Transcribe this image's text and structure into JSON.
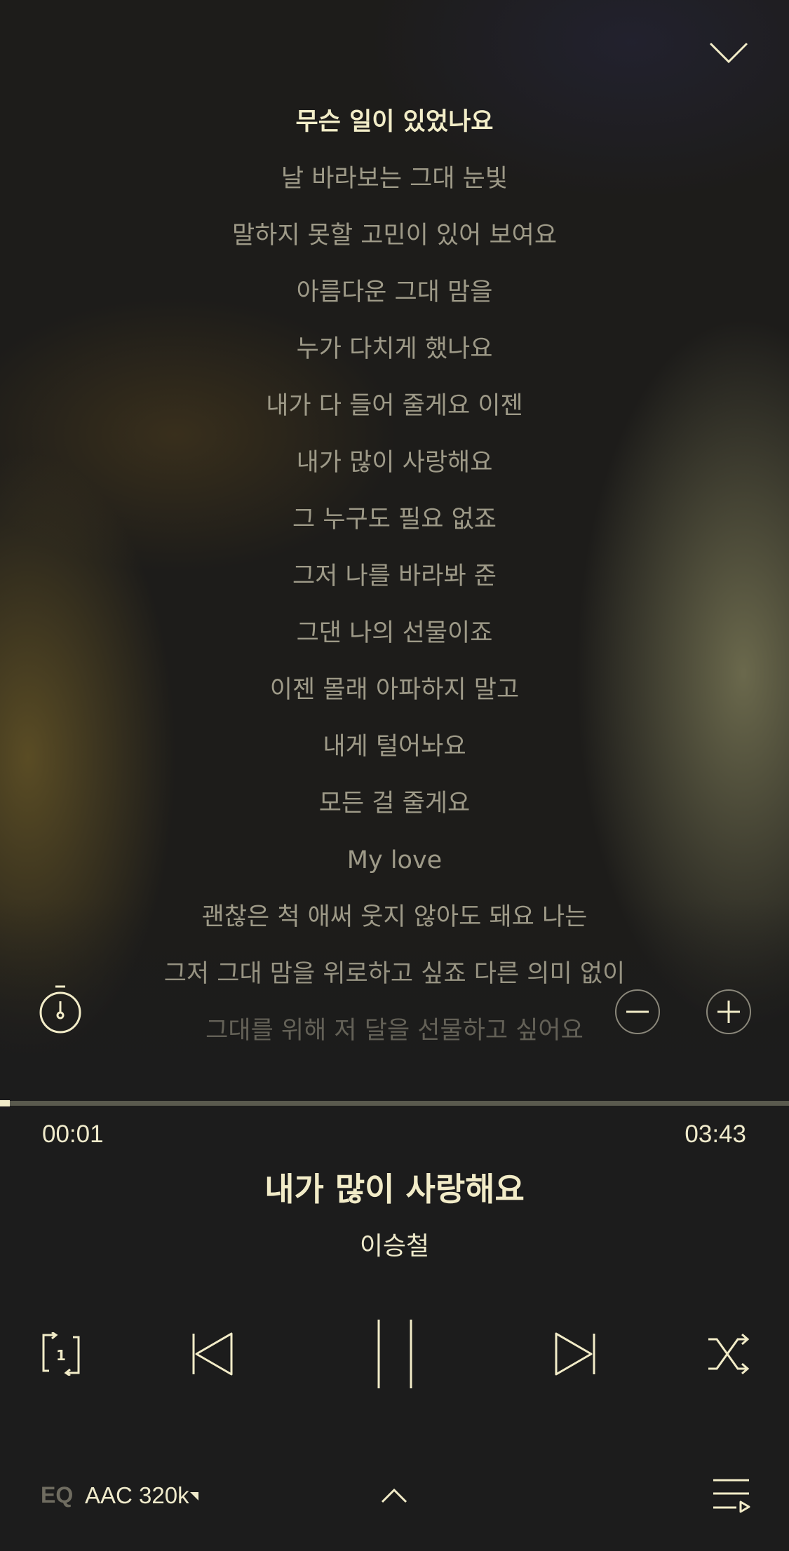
{
  "colors": {
    "accent": "#f2ecc8",
    "lyric_inactive": "#9e9a88",
    "background": "#1c1c1c"
  },
  "lyrics": [
    "무슨 일이 있었나요",
    "날 바라보는 그대 눈빛",
    "말하지 못할 고민이 있어 보여요",
    "아름다운 그대 맘을",
    "누가 다치게 했나요",
    "내가 다 들어 줄게요 이젠",
    "내가 많이 사랑해요",
    "그 누구도 필요 없죠",
    "그저 나를 바라봐 준",
    "그댄 나의 선물이죠",
    "이젠 몰래 아파하지 말고",
    "내게 털어놔요",
    "모든 걸 줄게요",
    "My love",
    "괜찮은 척 애써 웃지 않아도 돼요 나는",
    "그저 그대 맘을 위로하고 싶죠 다른 의미 없이",
    "그대를 위해 저 달을 선물하고 싶어요"
  ],
  "current_lyric_index": 0,
  "progress": {
    "elapsed": "00:01",
    "total": "03:43",
    "fraction": 0.005
  },
  "track": {
    "title": "내가 많이 사랑해요",
    "artist": "이승철"
  },
  "icons": {
    "collapse": "chevron-down-icon",
    "timer": "stopwatch-icon",
    "font_decrease": "minus-circle-icon",
    "font_increase": "plus-circle-icon",
    "repeat": "repeat-one-icon",
    "previous": "previous-track-icon",
    "pause": "pause-icon",
    "next": "next-track-icon",
    "shuffle": "shuffle-icon",
    "expand": "chevron-up-icon",
    "playlist": "playlist-icon"
  },
  "footer": {
    "eq_label": "EQ",
    "quality_label": "AAC 320k"
  }
}
